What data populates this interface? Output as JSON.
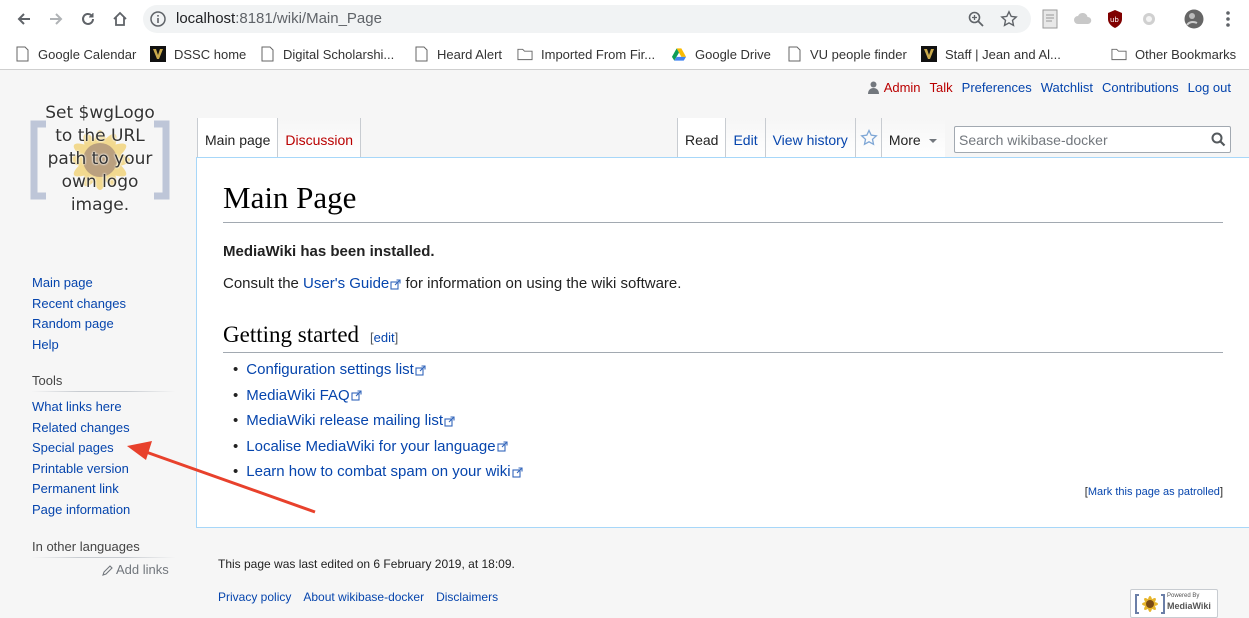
{
  "browser": {
    "url_host": "localhost",
    "url_rest": ":8181/wiki/Main_Page",
    "bookmarks": [
      {
        "label": "Google Calendar",
        "icon": "calendar-icon"
      },
      {
        "label": "DSSC home",
        "icon": "vanderbilt-icon"
      },
      {
        "label": "Digital Scholarshi...",
        "icon": "page-icon"
      },
      {
        "label": "Heard Alert",
        "icon": "page-icon"
      },
      {
        "label": "Imported From Fir...",
        "icon": "folder-icon"
      },
      {
        "label": "Google Drive",
        "icon": "google-drive-icon"
      },
      {
        "label": "VU people finder",
        "icon": "page-icon"
      },
      {
        "label": "Staff | Jean and Al...",
        "icon": "vanderbilt-icon"
      },
      {
        "label": "Other Bookmarks",
        "icon": "folder-icon"
      }
    ]
  },
  "logo": {
    "lines": [
      "Set $wgLogo",
      "to the URL",
      "path to your",
      "own logo",
      "image."
    ]
  },
  "personal": {
    "user": "Admin",
    "talk": "Talk",
    "preferences": "Preferences",
    "watchlist": "Watchlist",
    "contributions": "Contributions",
    "logout": "Log out"
  },
  "tabs": {
    "main_page": "Main page",
    "discussion": "Discussion",
    "read": "Read",
    "edit": "Edit",
    "view_history": "View history",
    "more": "More"
  },
  "search": {
    "placeholder": "Search wikibase-docker"
  },
  "content": {
    "title": "Main Page",
    "installed": "MediaWiki has been installed.",
    "consult_before": "Consult the ",
    "users_guide": "User's Guide",
    "consult_after": " for information on using the wiki software.",
    "getting_started": "Getting started",
    "edit_bracket_open": "[",
    "edit_label": "edit",
    "edit_bracket_close": "]",
    "links": [
      "Configuration settings list",
      "MediaWiki FAQ",
      "MediaWiki release mailing list",
      "Localise MediaWiki for your language",
      "Learn how to combat spam on your wiki"
    ],
    "patrol_open": "[",
    "patrol_label": "Mark this page as patrolled",
    "patrol_close": "]"
  },
  "sidebar": {
    "navigation": [
      "Main page",
      "Recent changes",
      "Random page",
      "Help"
    ],
    "tools_heading": "Tools",
    "tools": [
      "What links here",
      "Related changes",
      "Special pages",
      "Printable version",
      "Permanent link",
      "Page information"
    ],
    "languages_heading": "In other languages",
    "add_links": "Add links"
  },
  "footer": {
    "last_edited": "This page was last edited on 6 February 2019, at 18:09.",
    "links": [
      "Privacy policy",
      "About wikibase-docker",
      "Disclaimers"
    ],
    "powered_small": "Powered By",
    "powered_big": "MediaWiki"
  },
  "colors": {
    "link": "#0645ad",
    "new_link": "#ba0000",
    "annotation_arrow": "#e8412c"
  }
}
